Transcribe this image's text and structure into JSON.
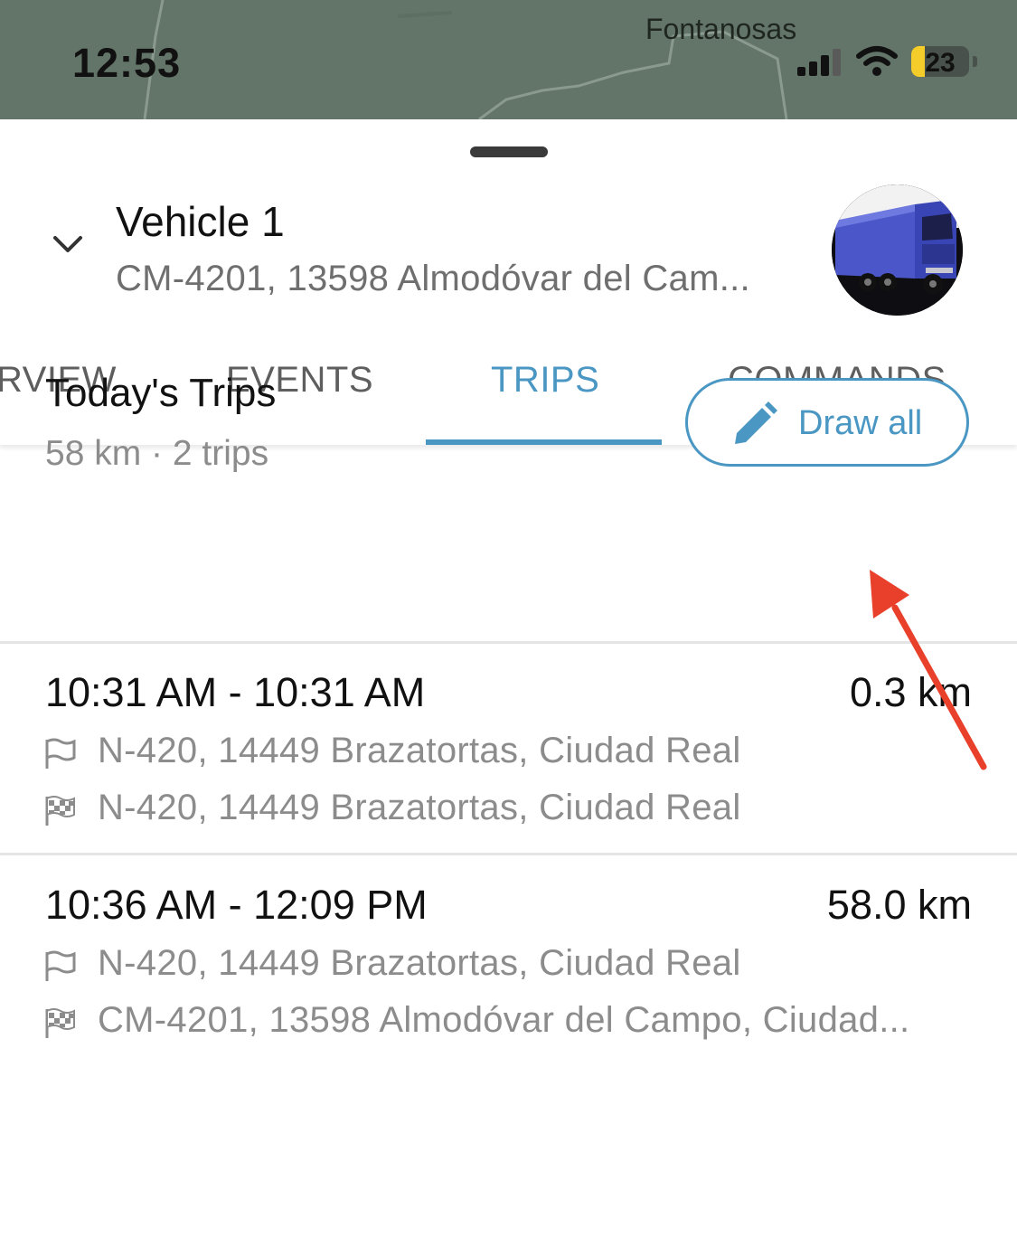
{
  "status_bar": {
    "time": "12:53",
    "battery": "23",
    "battery_level": 0.23
  },
  "map": {
    "place_label": "Fontanosas"
  },
  "vehicle": {
    "name": "Vehicle 1",
    "address": "CM-4201, 13598 Almodóvar del Cam..."
  },
  "tabs": [
    {
      "label": "RVIEW",
      "active": false
    },
    {
      "label": "EVENTS",
      "active": false
    },
    {
      "label": "TRIPS",
      "active": true
    },
    {
      "label": "COMMANDS",
      "active": false
    }
  ],
  "summary": {
    "title": "Today's Trips",
    "subtitle": "58 km · 2 trips",
    "draw_button": "Draw all"
  },
  "trips": [
    {
      "time_range": "10:31 AM - 10:31 AM",
      "distance": "0.3 km",
      "start": "N-420, 14449 Brazatortas, Ciudad Real",
      "end": "N-420, 14449 Brazatortas, Ciudad Real"
    },
    {
      "time_range": "10:36 AM - 12:09 PM",
      "distance": "58.0 km",
      "start": "N-420, 14449 Brazatortas, Ciudad Real",
      "end": "CM-4201, 13598 Almodóvar del Campo, Ciudad..."
    }
  ],
  "colors": {
    "accent": "#4a97c4",
    "annotation_arrow": "#e8402a",
    "map": "#637468"
  },
  "icons": {
    "start": "flag-outline-icon",
    "end": "checkered-flag-icon",
    "draw": "pencil-icon",
    "collapse": "chevron-down-icon"
  }
}
